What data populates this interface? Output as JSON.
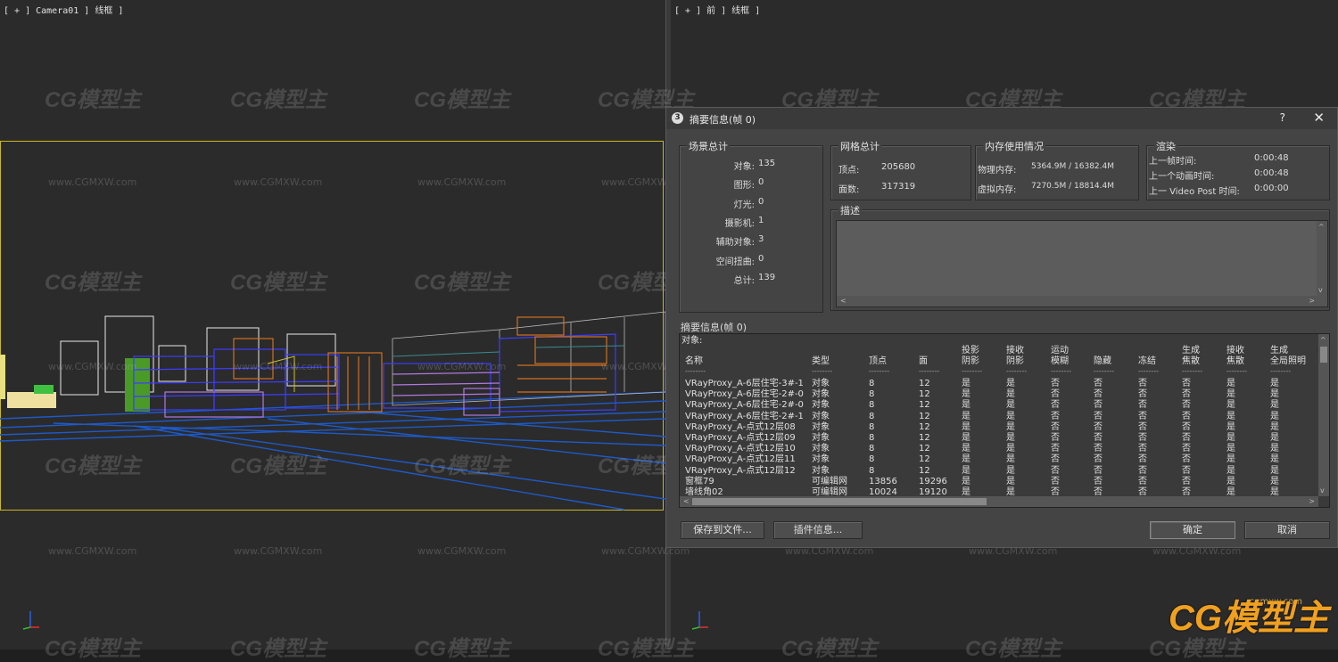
{
  "viewports": {
    "left_label": "[ + ] Camera01 ] 线框 ]",
    "right_label": "[ + ] 前 ] 线框 ]"
  },
  "watermark": {
    "logo_text": "CG模型主",
    "url_text": "www.CGMXW.com",
    "brand_url": "cgmxw.com"
  },
  "dialog": {
    "title": "摘要信息(帧 0)",
    "help": "?",
    "close": "✕",
    "scene_totals": {
      "title": "场景总计",
      "items": [
        {
          "label": "对象:",
          "value": "135"
        },
        {
          "label": "图形:",
          "value": "0"
        },
        {
          "label": "灯光:",
          "value": "0"
        },
        {
          "label": "摄影机:",
          "value": "1"
        },
        {
          "label": "辅助对象:",
          "value": "3"
        },
        {
          "label": "空间扭曲:",
          "value": "0"
        },
        {
          "label": "总计:",
          "value": "139"
        }
      ]
    },
    "mesh_totals": {
      "title": "网格总计",
      "items": [
        {
          "label": "顶点:",
          "value": "205680"
        },
        {
          "label": "面数:",
          "value": "317319"
        }
      ]
    },
    "memory": {
      "title": "内存使用情况",
      "items": [
        {
          "label": "物理内存:",
          "value": "5364.9M / 16382.4M"
        },
        {
          "label": "虚拟内存:",
          "value": "7270.5M / 18814.4M"
        }
      ]
    },
    "render": {
      "title": "渲染",
      "items": [
        {
          "label": "上一帧时间:",
          "value": "0:00:48"
        },
        {
          "label": "上一个动画时间:",
          "value": "0:00:48"
        },
        {
          "label": "上一 Video Post 时间:",
          "value": "0:00:00"
        }
      ]
    },
    "description": {
      "title": "描述",
      "value": ""
    },
    "summary": {
      "title": "摘要信息(帧 0)",
      "objects_label": "对象:",
      "columns": [
        {
          "line1": "",
          "line2": "名称"
        },
        {
          "line1": "",
          "line2": "类型"
        },
        {
          "line1": "",
          "line2": "顶点"
        },
        {
          "line1": "",
          "line2": "面"
        },
        {
          "line1": "投影",
          "line2": "阴影"
        },
        {
          "line1": "接收",
          "line2": "阴影"
        },
        {
          "line1": "运动",
          "line2": "模糊"
        },
        {
          "line1": "",
          "line2": "隐藏"
        },
        {
          "line1": "",
          "line2": "冻结"
        },
        {
          "line1": "生成",
          "line2": "焦散"
        },
        {
          "line1": "接收",
          "line2": "焦散"
        },
        {
          "line1": "生成",
          "line2": "全局照明"
        }
      ],
      "rows": [
        [
          "VRayProxy_A-6层住宅-3#-1",
          "对象",
          "8",
          "12",
          "是",
          "是",
          "否",
          "否",
          "否",
          "否",
          "是",
          "是"
        ],
        [
          "VRayProxy_A-6层住宅-2#-0",
          "对象",
          "8",
          "12",
          "是",
          "是",
          "否",
          "否",
          "否",
          "否",
          "是",
          "是"
        ],
        [
          "VRayProxy_A-6层住宅-2#-0",
          "对象",
          "8",
          "12",
          "是",
          "是",
          "否",
          "否",
          "否",
          "否",
          "是",
          "是"
        ],
        [
          "VRayProxy_A-6层住宅-2#-1",
          "对象",
          "8",
          "12",
          "是",
          "是",
          "否",
          "否",
          "否",
          "否",
          "是",
          "是"
        ],
        [
          "VRayProxy_A-点式12层08",
          "对象",
          "8",
          "12",
          "是",
          "是",
          "否",
          "否",
          "否",
          "否",
          "是",
          "是"
        ],
        [
          "VRayProxy_A-点式12层09",
          "对象",
          "8",
          "12",
          "是",
          "是",
          "否",
          "否",
          "否",
          "否",
          "是",
          "是"
        ],
        [
          "VRayProxy_A-点式12层10",
          "对象",
          "8",
          "12",
          "是",
          "是",
          "否",
          "否",
          "否",
          "否",
          "是",
          "是"
        ],
        [
          "VRayProxy_A-点式12层11",
          "对象",
          "8",
          "12",
          "是",
          "是",
          "否",
          "否",
          "否",
          "否",
          "是",
          "是"
        ],
        [
          "VRayProxy_A-点式12层12",
          "对象",
          "8",
          "12",
          "是",
          "是",
          "否",
          "否",
          "否",
          "否",
          "是",
          "是"
        ],
        [
          "窗框79",
          "可编辑网",
          "13856",
          "19296",
          "是",
          "是",
          "否",
          "否",
          "否",
          "否",
          "是",
          "是"
        ],
        [
          "墙线角02",
          "可编辑网",
          "10024",
          "19120",
          "是",
          "是",
          "否",
          "否",
          "否",
          "否",
          "是",
          "是"
        ]
      ]
    },
    "buttons": {
      "save": "保存到文件...",
      "plugin": "插件信息...",
      "ok": "确定",
      "cancel": "取消"
    }
  }
}
